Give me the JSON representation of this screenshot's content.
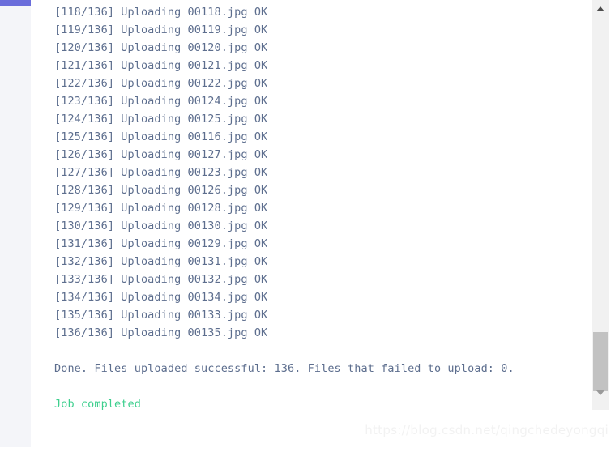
{
  "sidebar": {
    "accent_color": "#6a6ddb",
    "background_color": "#f4f5f9"
  },
  "console": {
    "text_color": "#5d6e8e",
    "success_color": "#3ecf8e",
    "background_color": "#ffffff",
    "log_lines": [
      "[118/136] Uploading 00118.jpg OK",
      "[119/136] Uploading 00119.jpg OK",
      "[120/136] Uploading 00120.jpg OK",
      "[121/136] Uploading 00121.jpg OK",
      "[122/136] Uploading 00122.jpg OK",
      "[123/136] Uploading 00124.jpg OK",
      "[124/136] Uploading 00125.jpg OK",
      "[125/136] Uploading 00116.jpg OK",
      "[126/136] Uploading 00127.jpg OK",
      "[127/136] Uploading 00123.jpg OK",
      "[128/136] Uploading 00126.jpg OK",
      "[129/136] Uploading 00128.jpg OK",
      "[130/136] Uploading 00130.jpg OK",
      "[131/136] Uploading 00129.jpg OK",
      "[132/136] Uploading 00131.jpg OK",
      "[133/136] Uploading 00132.jpg OK",
      "[134/136] Uploading 00134.jpg OK",
      "[135/136] Uploading 00133.jpg OK",
      "[136/136] Uploading 00135.jpg OK"
    ],
    "summary": "Done. Files uploaded successful: 136. Files that failed to upload: 0.",
    "status": "Job completed"
  },
  "scrollbar": {
    "up_arrow_icon": "triangle-up-icon",
    "down_arrow_icon": "triangle-down-icon",
    "thumb_color": "#c2c2c2",
    "track_color": "#f1f1f1"
  },
  "watermark": {
    "text": "https://blog.csdn.net/qingchedeyongqi"
  }
}
